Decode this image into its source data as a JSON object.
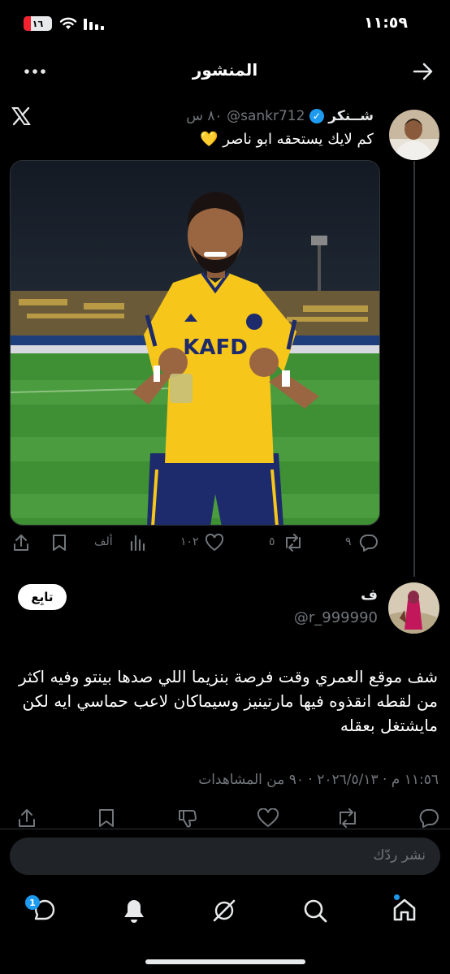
{
  "status_bar": {
    "time": "١١:٥٩",
    "battery": "١٦"
  },
  "header": {
    "title": "المنشور"
  },
  "parent_post": {
    "display_name": "شــنكر",
    "handle": "@sankr712",
    "time_ago": "٨٠ س",
    "text": "كم لايك يستحقه ابو ناصر 💛",
    "replies": "٩",
    "reposts": "٥",
    "likes": "١٠٢",
    "views": "ألف"
  },
  "main_post": {
    "display_name": "ف",
    "handle": "@r_999990",
    "follow_label": "تابِع",
    "text": "شف موقع العمري وقت فرصة بنزيما اللي صدها بينتو وفيه اكثر من لقطه انقذوه فيها مارتينيز وسيماكان لاعب حماسي ايه لكن مايشتغل بعقله",
    "meta": "١١:٥٦ م · ٢٠٢٦/٥/١٣ · ٩٠ من المشاهدات"
  },
  "reply_composer": {
    "placeholder": "نشر ردّك"
  },
  "bottom_nav": {
    "messages_badge": "1"
  },
  "colors": {
    "background": "#000000",
    "text": "#e7e9ea",
    "muted": "#71767b",
    "accent": "#1d9bf0",
    "jersey_yellow": "#f6c61b",
    "jersey_navy": "#1d2a6b",
    "pitch_green": "#3f8f35"
  },
  "icons": [
    "forward-arrow-icon",
    "more-icon",
    "x-logo-icon",
    "verified-icon",
    "reply-icon",
    "repost-icon",
    "like-icon",
    "views-icon",
    "bookmark-icon",
    "share-icon",
    "dislike-icon",
    "home-icon",
    "search-icon",
    "grok-icon",
    "notifications-icon",
    "messages-icon"
  ]
}
